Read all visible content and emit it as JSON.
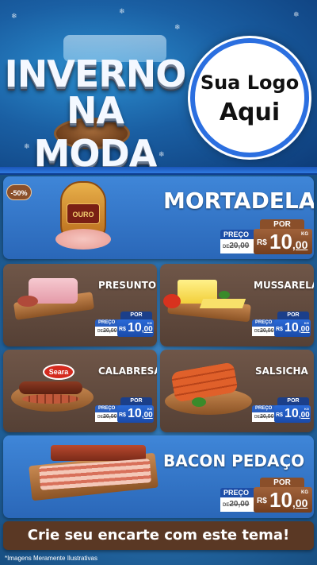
{
  "header": {
    "title_line1": "INVERNO",
    "title_line2": "NA MODA",
    "logo_line1": "Sua Logo",
    "logo_line2": "Aqui"
  },
  "featured_top": {
    "discount_badge": "-50%",
    "name": "MORTADELA",
    "brand_label": "OURO",
    "price_label": "PREÇO",
    "por_label": "POR",
    "old_prefix": "DE",
    "old_price": "20,00",
    "currency": "R$",
    "new_price_int": "10",
    "new_price_cents": ",00",
    "unit": "KG"
  },
  "products": [
    {
      "name": "PRESUNTO",
      "price_label": "PREÇO",
      "por_label": "POR",
      "old_prefix": "DE",
      "old_price": "20,00",
      "currency": "R$",
      "new_price_int": "10",
      "new_price_cents": ",00",
      "unit": "KG"
    },
    {
      "name": "MUSSARELA",
      "price_label": "PREÇO",
      "por_label": "POR",
      "old_prefix": "DE",
      "old_price": "20,00",
      "currency": "R$",
      "new_price_int": "10",
      "new_price_cents": ",00",
      "unit": "KG"
    },
    {
      "name": "CALABRESA",
      "brand_label": "Seara",
      "price_label": "PREÇO",
      "por_label": "POR",
      "old_prefix": "DE",
      "old_price": "20,00",
      "currency": "R$",
      "new_price_int": "10",
      "new_price_cents": ",00",
      "unit": "KG"
    },
    {
      "name": "SALSICHA",
      "price_label": "PREÇO",
      "por_label": "POR",
      "old_prefix": "DE",
      "old_price": "20,00",
      "currency": "R$",
      "new_price_int": "10",
      "new_price_cents": ",00",
      "unit": "KG"
    }
  ],
  "featured_bottom": {
    "name": "BACON PEDAÇO",
    "price_label": "PREÇO",
    "por_label": "POR",
    "old_prefix": "DE",
    "old_price": "20,00",
    "currency": "R$",
    "new_price_int": "10",
    "new_price_cents": ",00",
    "unit": "KG"
  },
  "footer": {
    "cta": "Crie seu encarte com este tema!",
    "disclaimer": "*Imagens Meramente Ilustrativas"
  },
  "colors": {
    "header_blue": "#1a5fa3",
    "card_blue": "#3f86d8",
    "card_brown": "#6f5648",
    "price_brown": "#8a4f2a",
    "footer_brown": "#5a3824"
  }
}
